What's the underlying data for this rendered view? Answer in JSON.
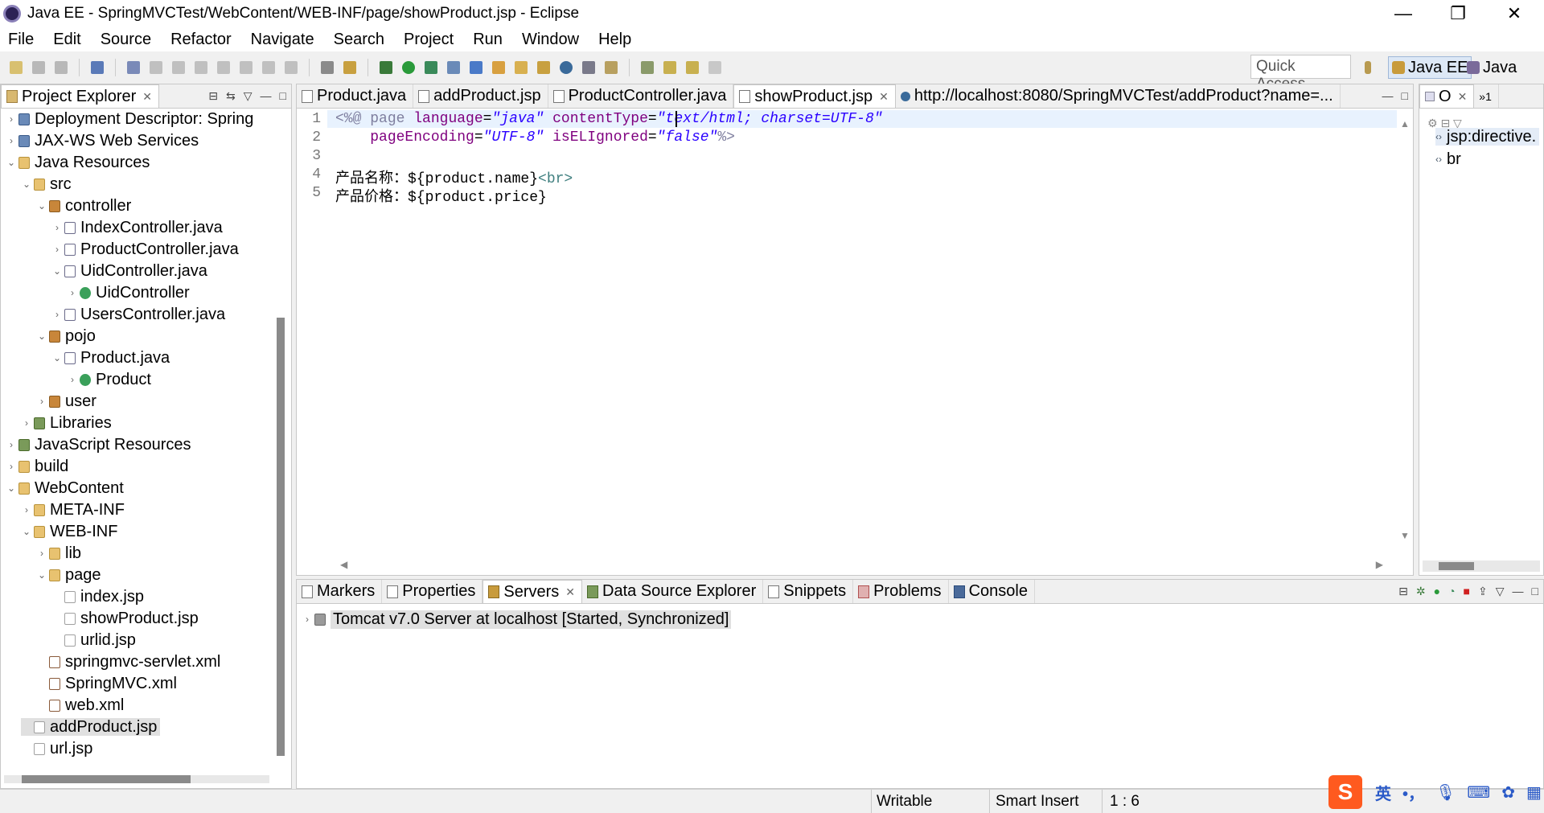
{
  "window": {
    "title": "Java EE - SpringMVCTest/WebContent/WEB-INF/page/showProduct.jsp - Eclipse",
    "minimize": "—",
    "maximize": "❐",
    "close": "✕"
  },
  "menu": [
    "File",
    "Edit",
    "Source",
    "Refactor",
    "Navigate",
    "Search",
    "Project",
    "Run",
    "Window",
    "Help"
  ],
  "toolbar": {
    "quick_access": "Quick Access",
    "perspective_active": "Java EE",
    "perspective_other": "Java"
  },
  "project_explorer": {
    "title": "Project Explorer",
    "items": [
      {
        "label": "Deployment Descriptor: Spring",
        "level": 1,
        "arrow": "›",
        "icon": "i-proj"
      },
      {
        "label": "JAX-WS Web Services",
        "level": 1,
        "arrow": "›",
        "icon": "i-proj"
      },
      {
        "label": "Java Resources",
        "level": 1,
        "arrow": "⌄",
        "icon": "i-folder"
      },
      {
        "label": "src",
        "level": 2,
        "arrow": "⌄",
        "icon": "i-folder"
      },
      {
        "label": "controller",
        "level": 3,
        "arrow": "⌄",
        "icon": "i-pkg"
      },
      {
        "label": "IndexController.java",
        "level": 4,
        "arrow": "›",
        "icon": "i-java"
      },
      {
        "label": "ProductController.java",
        "level": 4,
        "arrow": "›",
        "icon": "i-java"
      },
      {
        "label": "UidController.java",
        "level": 4,
        "arrow": "⌄",
        "icon": "i-java"
      },
      {
        "label": "UidController",
        "level": 5,
        "arrow": "›",
        "icon": "i-class"
      },
      {
        "label": "UsersController.java",
        "level": 4,
        "arrow": "›",
        "icon": "i-java"
      },
      {
        "label": "pojo",
        "level": 3,
        "arrow": "⌄",
        "icon": "i-pkg"
      },
      {
        "label": "Product.java",
        "level": 4,
        "arrow": "⌄",
        "icon": "i-java"
      },
      {
        "label": "Product",
        "level": 5,
        "arrow": "›",
        "icon": "i-class"
      },
      {
        "label": "user",
        "level": 3,
        "arrow": "›",
        "icon": "i-pkg"
      },
      {
        "label": "Libraries",
        "level": 2,
        "arrow": "›",
        "icon": "i-lib"
      },
      {
        "label": "JavaScript Resources",
        "level": 1,
        "arrow": "›",
        "icon": "i-lib"
      },
      {
        "label": "build",
        "level": 1,
        "arrow": "›",
        "icon": "i-folder"
      },
      {
        "label": "WebContent",
        "level": 1,
        "arrow": "⌄",
        "icon": "i-folder"
      },
      {
        "label": "META-INF",
        "level": 2,
        "arrow": "›",
        "icon": "i-folder"
      },
      {
        "label": "WEB-INF",
        "level": 2,
        "arrow": "⌄",
        "icon": "i-folder"
      },
      {
        "label": "lib",
        "level": 3,
        "arrow": "›",
        "icon": "i-folder"
      },
      {
        "label": "page",
        "level": 3,
        "arrow": "⌄",
        "icon": "i-folder"
      },
      {
        "label": "index.jsp",
        "level": 4,
        "arrow": "",
        "icon": "i-jsp"
      },
      {
        "label": "showProduct.jsp",
        "level": 4,
        "arrow": "",
        "icon": "i-jsp"
      },
      {
        "label": "urlid.jsp",
        "level": 4,
        "arrow": "",
        "icon": "i-jsp"
      },
      {
        "label": "springmvc-servlet.xml",
        "level": 3,
        "arrow": "",
        "icon": "i-xml"
      },
      {
        "label": "SpringMVC.xml",
        "level": 3,
        "arrow": "",
        "icon": "i-xml"
      },
      {
        "label": "web.xml",
        "level": 3,
        "arrow": "",
        "icon": "i-xml"
      },
      {
        "label": "addProduct.jsp",
        "level": 2,
        "arrow": "",
        "icon": "i-jsp",
        "selected": true
      },
      {
        "label": "url.jsp",
        "level": 2,
        "arrow": "",
        "icon": "i-jsp"
      }
    ]
  },
  "editor": {
    "tabs": [
      {
        "label": "Product.java",
        "active": false
      },
      {
        "label": "addProduct.jsp",
        "active": false
      },
      {
        "label": "ProductController.java",
        "active": false
      },
      {
        "label": "showProduct.jsp",
        "active": true
      },
      {
        "label": "http://localhost:8080/SpringMVCTest/addProduct?name=...",
        "active": false
      }
    ],
    "line_numbers": [
      "1",
      "2",
      "3",
      "4",
      "5"
    ],
    "lines": [
      {
        "segments": [
          [
            "kw-dir",
            "<%@ "
          ],
          [
            "kw-dir",
            "page "
          ],
          [
            "kw-attr",
            "language"
          ],
          [
            "",
            "="
          ],
          [
            "kw-val",
            "\"java\""
          ],
          [
            "",
            " "
          ],
          [
            "kw-attr",
            "contentType"
          ],
          [
            "",
            "="
          ],
          [
            "kw-val",
            "\"text/html; charset=UTF-8\""
          ]
        ]
      },
      {
        "segments": [
          [
            "",
            "    "
          ],
          [
            "kw-attr",
            "pageEncoding"
          ],
          [
            "",
            "="
          ],
          [
            "kw-val",
            "\"UTF-8\""
          ],
          [
            "",
            " "
          ],
          [
            "kw-attr",
            "isELIgnored"
          ],
          [
            "",
            "="
          ],
          [
            "kw-val",
            "\"false\""
          ],
          [
            "kw-dir",
            "%>"
          ]
        ]
      },
      {
        "segments": []
      },
      {
        "segments": [
          [
            "",
            "产品名称："
          ],
          [
            "",
            "${product.name}"
          ],
          [
            "kw-tag",
            "<br>"
          ]
        ]
      },
      {
        "segments": [
          [
            "",
            "产品价格："
          ],
          [
            "",
            "${product.price}"
          ]
        ]
      }
    ]
  },
  "outline": {
    "title": "O",
    "overflow": "»1",
    "items": [
      "jsp:directive.",
      "br"
    ]
  },
  "bottom": {
    "tabs": [
      {
        "label": "Markers",
        "active": false
      },
      {
        "label": "Properties",
        "active": false
      },
      {
        "label": "Servers",
        "active": true
      },
      {
        "label": "Data Source Explorer",
        "active": false
      },
      {
        "label": "Snippets",
        "active": false
      },
      {
        "label": "Problems",
        "active": false
      },
      {
        "label": "Console",
        "active": false
      }
    ],
    "server": "Tomcat v7.0 Server at localhost  [Started, Synchronized]"
  },
  "status": {
    "writable": "Writable",
    "insert_mode": "Smart Insert",
    "position": "1 : 6"
  },
  "ime": {
    "lang": "英",
    "punct": "•，"
  },
  "colors": {
    "accent": "#3399ff",
    "selection": "#e0e0e0",
    "current_line": "#e8f2fe"
  }
}
